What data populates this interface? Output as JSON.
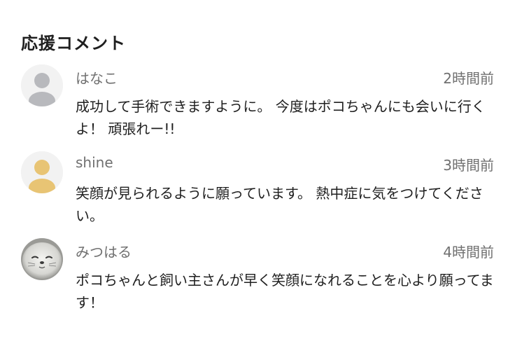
{
  "section": {
    "title": "応援コメント"
  },
  "comments": [
    {
      "author": "はなこ",
      "time": "2時間前",
      "text": "成功して手術できますように。 今度はポコちゃんにも会いに行くよ！ 頑張れー!!",
      "avatar_icon": "default-user-icon",
      "avatar_color": "#b8b9bd"
    },
    {
      "author": "shine",
      "time": "3時間前",
      "text": "笑顔が見られるように願っています。 熱中症に気をつけてください。",
      "avatar_icon": "default-user-icon",
      "avatar_color": "#e8c474"
    },
    {
      "author": "みつはる",
      "time": "4時間前",
      "text": "ポコちゃんと飼い主さんが早く笑顔になれることを心より願ってます！",
      "avatar_icon": "seal-photo-avatar",
      "avatar_color": "#d9d9d6"
    }
  ]
}
